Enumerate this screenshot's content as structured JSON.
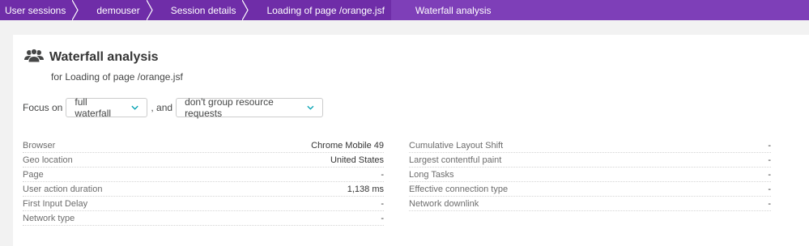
{
  "breadcrumb": [
    {
      "label": "User sessions"
    },
    {
      "label": "demouser"
    },
    {
      "label": "Session details"
    },
    {
      "label": "Loading of page /orange.jsf"
    },
    {
      "label": "Waterfall analysis"
    }
  ],
  "header": {
    "icon": "users-icon",
    "title": "Waterfall analysis",
    "subtitle": "for Loading of page /orange.jsf"
  },
  "focus": {
    "prefix": "Focus on",
    "select1": "full waterfall",
    "connector": ", and",
    "select2": "don't group resource requests"
  },
  "properties_left": [
    {
      "label": "Browser",
      "value": "Chrome Mobile 49"
    },
    {
      "label": "Geo location",
      "value": "United States"
    },
    {
      "label": "Page",
      "value": "-"
    },
    {
      "label": "User action duration",
      "value": "1,138 ms"
    },
    {
      "label": "First Input Delay",
      "value": "-"
    },
    {
      "label": "Network type",
      "value": "-"
    }
  ],
  "properties_right": [
    {
      "label": "Cumulative Layout Shift",
      "value": "-"
    },
    {
      "label": "Largest contentful paint",
      "value": "-"
    },
    {
      "label": "Long Tasks",
      "value": "-"
    },
    {
      "label": "Effective connection type",
      "value": "-"
    },
    {
      "label": "Network downlink",
      "value": "-"
    }
  ],
  "colors": {
    "breadcrumb_bg": "#6f2da8",
    "breadcrumb_current": "#7e3fb8",
    "accent": "#00a1b2"
  }
}
